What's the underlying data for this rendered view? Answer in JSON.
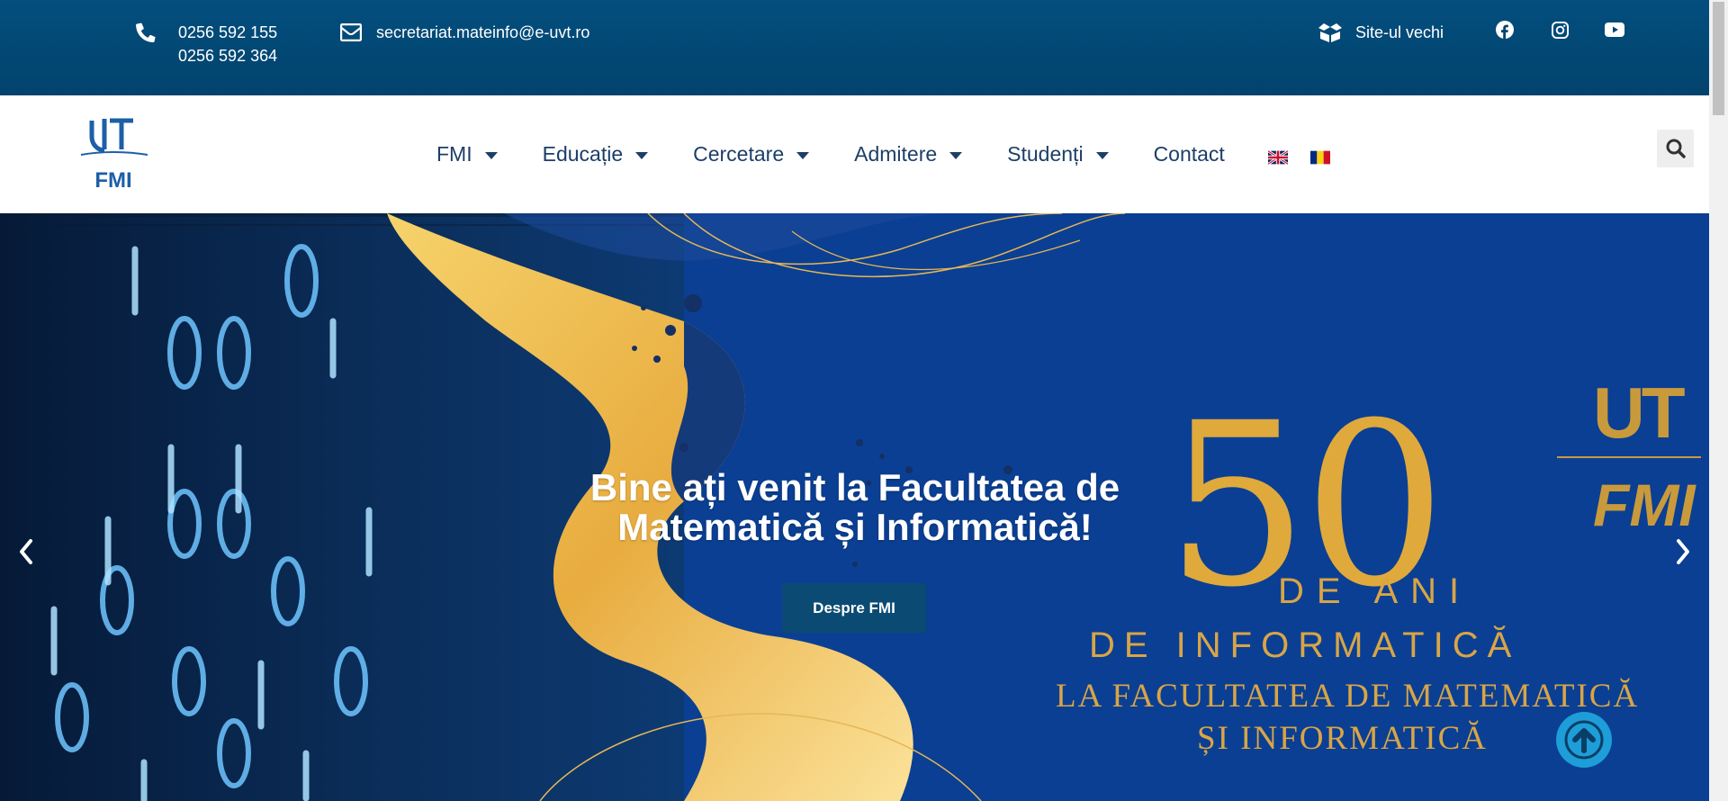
{
  "topbar": {
    "phone1": "0256 592 155",
    "phone2": "0256 592 364",
    "email": "secretariat.mateinfo@e-uvt.ro",
    "old_site": "Site-ul vechi",
    "social": [
      "facebook-icon",
      "instagram-icon",
      "youtube-icon"
    ]
  },
  "header": {
    "logo_text": "FMI",
    "nav": [
      {
        "label": "FMI",
        "dropdown": true
      },
      {
        "label": "Educație",
        "dropdown": true
      },
      {
        "label": "Cercetare",
        "dropdown": true
      },
      {
        "label": "Admitere",
        "dropdown": true
      },
      {
        "label": "Studenți",
        "dropdown": true
      },
      {
        "label": "Contact",
        "dropdown": false
      }
    ],
    "languages": [
      "en-flag",
      "ro-flag"
    ]
  },
  "hero": {
    "title": "Bine ați venit la Facultatea de Matematică și Informatică!",
    "button": "Despre FMI",
    "banner_50": "50",
    "banner_line1": "DE ANI",
    "banner_line2": "DE INFORMATICĂ",
    "banner_line3": "LA FACULTATEA DE MATEMATICĂ",
    "banner_line4": "ȘI INFORMATICĂ",
    "banner_logo": "FMI"
  },
  "colors": {
    "topbar": "#02436d",
    "nav_text": "#1d3e68",
    "button": "#0b4b73",
    "gold": "#e0a93c",
    "to_top": "#1d9ed8"
  }
}
